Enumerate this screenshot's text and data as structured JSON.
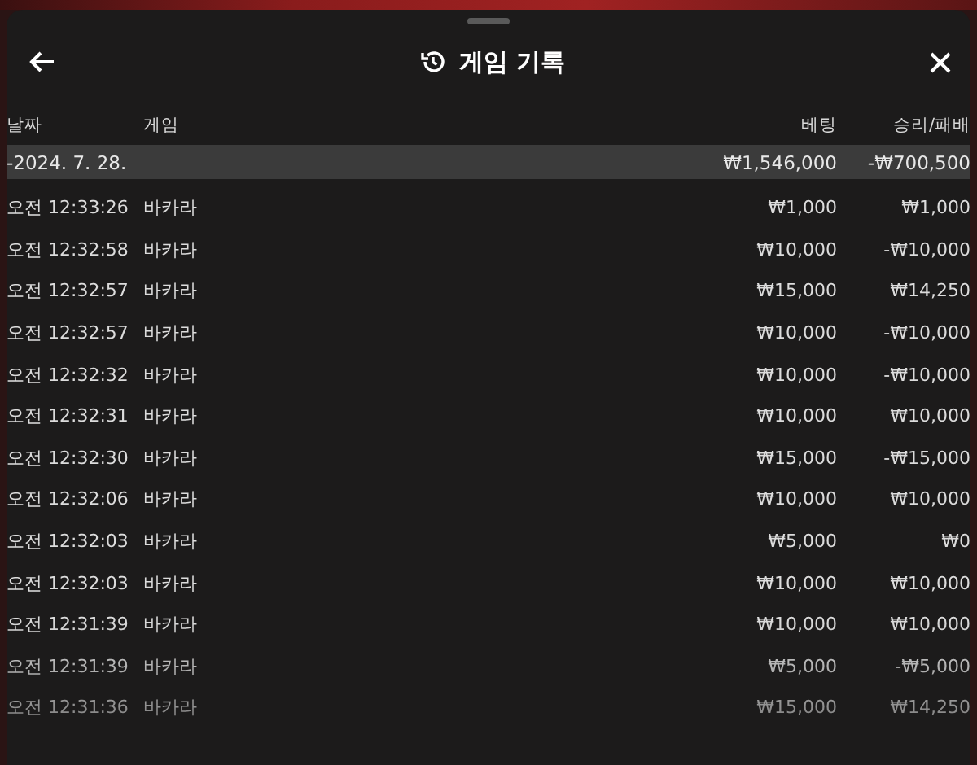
{
  "header": {
    "title": "게임 기록"
  },
  "columns": [
    "날짜",
    "게임",
    "베팅",
    "승리/패배"
  ],
  "group": {
    "date": "-2024. 7. 28.",
    "bet": "₩1,546,000",
    "result": "-₩700,500"
  },
  "rows": [
    {
      "time": "오전 12:33:26",
      "game": "바카라",
      "bet": "₩1,000",
      "result": "₩1,000"
    },
    {
      "time": "오전 12:32:58",
      "game": "바카라",
      "bet": "₩10,000",
      "result": "-₩10,000"
    },
    {
      "time": "오전 12:32:57",
      "game": "바카라",
      "bet": "₩15,000",
      "result": "₩14,250"
    },
    {
      "time": "오전 12:32:57",
      "game": "바카라",
      "bet": "₩10,000",
      "result": "-₩10,000"
    },
    {
      "time": "오전 12:32:32",
      "game": "바카라",
      "bet": "₩10,000",
      "result": "-₩10,000"
    },
    {
      "time": "오전 12:32:31",
      "game": "바카라",
      "bet": "₩10,000",
      "result": "₩10,000"
    },
    {
      "time": "오전 12:32:30",
      "game": "바카라",
      "bet": "₩15,000",
      "result": "-₩15,000"
    },
    {
      "time": "오전 12:32:06",
      "game": "바카라",
      "bet": "₩10,000",
      "result": "₩10,000"
    },
    {
      "time": "오전 12:32:03",
      "game": "바카라",
      "bet": "₩5,000",
      "result": "₩0"
    },
    {
      "time": "오전 12:32:03",
      "game": "바카라",
      "bet": "₩10,000",
      "result": "₩10,000"
    },
    {
      "time": "오전 12:31:39",
      "game": "바카라",
      "bet": "₩10,000",
      "result": "₩10,000"
    },
    {
      "time": "오전 12:31:39",
      "game": "바카라",
      "bet": "₩5,000",
      "result": "-₩5,000"
    },
    {
      "time": "오전 12:31:36",
      "game": "바카라",
      "bet": "₩15,000",
      "result": "₩14,250"
    }
  ]
}
